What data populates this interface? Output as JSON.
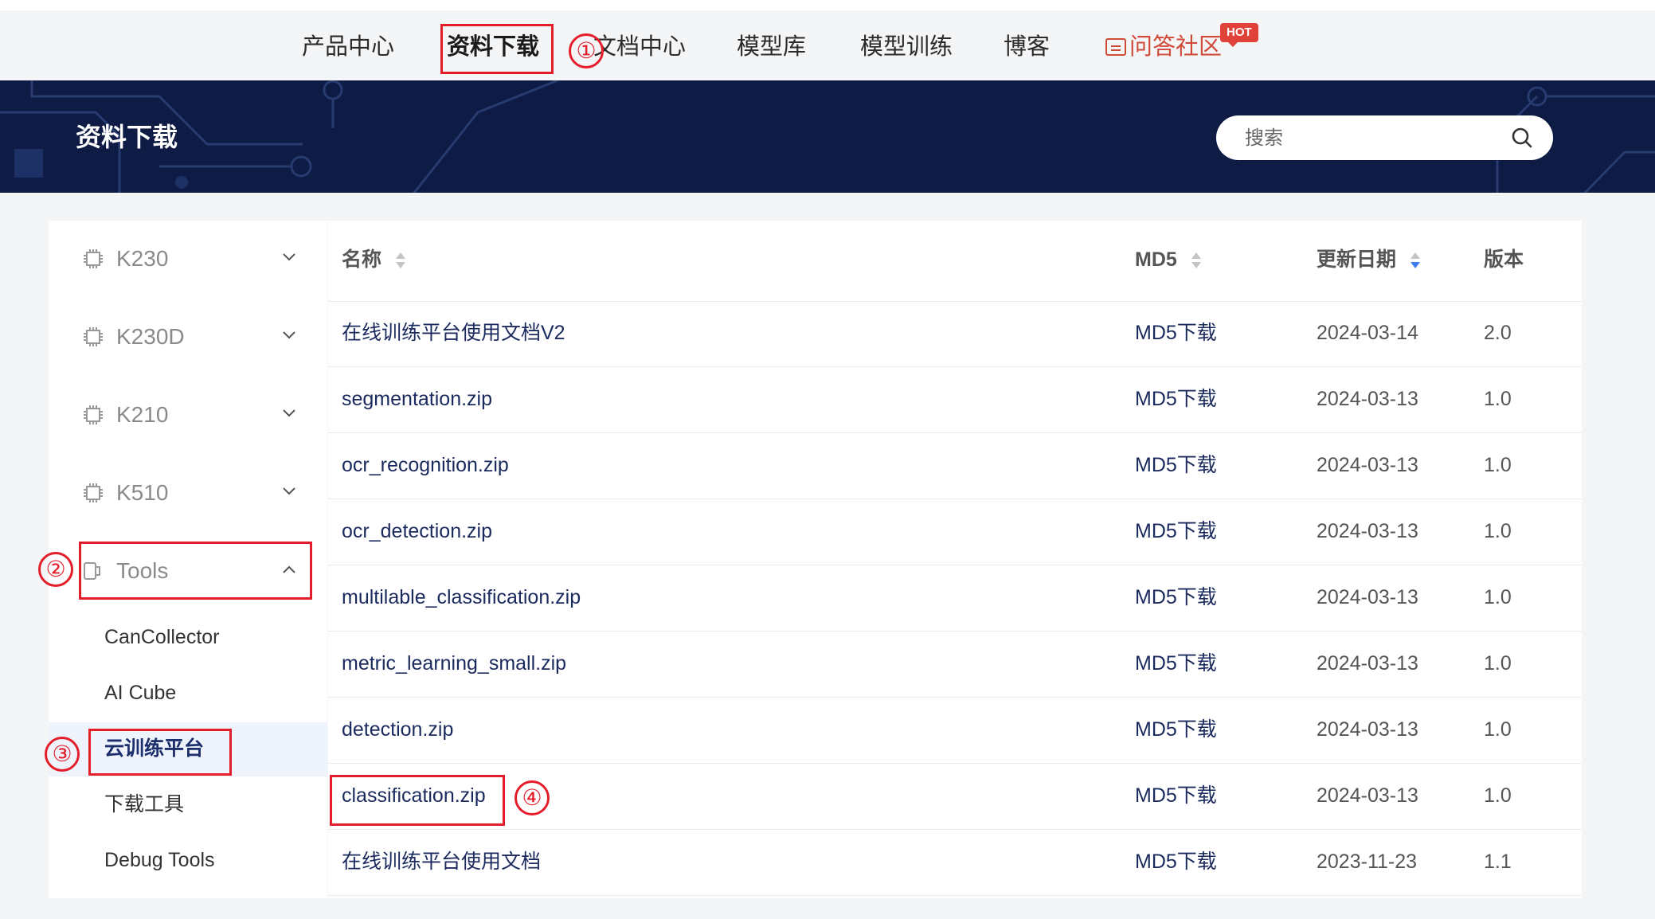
{
  "nav": {
    "items": [
      "产品中心",
      "资料下载",
      "文档中心",
      "模型库",
      "模型训练",
      "博客",
      "问答社区"
    ],
    "hot_badge": "HOT"
  },
  "banner": {
    "title": "资料下载",
    "search_placeholder": "搜索"
  },
  "sidebar": {
    "categories": [
      "K230",
      "K230D",
      "K210",
      "K510",
      "Tools"
    ],
    "tools_items": [
      "CanCollector",
      "AI Cube",
      "云训练平台",
      "下载工具",
      "Debug Tools"
    ],
    "active_item": "云训练平台"
  },
  "table": {
    "headers": {
      "name": "名称",
      "md5": "MD5",
      "date": "更新日期",
      "version": "版本"
    },
    "rows": [
      {
        "name": "在线训练平台使用文档V2",
        "md5": "MD5下载",
        "date": "2024-03-14",
        "version": "2.0"
      },
      {
        "name": "segmentation.zip",
        "md5": "MD5下载",
        "date": "2024-03-13",
        "version": "1.0"
      },
      {
        "name": "ocr_recognition.zip",
        "md5": "MD5下载",
        "date": "2024-03-13",
        "version": "1.0"
      },
      {
        "name": "ocr_detection.zip",
        "md5": "MD5下载",
        "date": "2024-03-13",
        "version": "1.0"
      },
      {
        "name": "multilable_classification.zip",
        "md5": "MD5下载",
        "date": "2024-03-13",
        "version": "1.0"
      },
      {
        "name": "metric_learning_small.zip",
        "md5": "MD5下载",
        "date": "2024-03-13",
        "version": "1.0"
      },
      {
        "name": "detection.zip",
        "md5": "MD5下载",
        "date": "2024-03-13",
        "version": "1.0"
      },
      {
        "name": "classification.zip",
        "md5": "MD5下载",
        "date": "2024-03-13",
        "version": "1.0"
      },
      {
        "name": "在线训练平台使用文档",
        "md5": "MD5下载",
        "date": "2023-11-23",
        "version": "1.1"
      }
    ]
  },
  "annotations": [
    "①",
    "②",
    "③",
    "④"
  ],
  "colors": {
    "banner_bg": "#0d1b45",
    "annotation_red": "#e41d2a",
    "community_red": "#d04a3a",
    "active_sidebar_bg": "#eef3fc",
    "sort_active_blue": "#3d7ef0"
  }
}
